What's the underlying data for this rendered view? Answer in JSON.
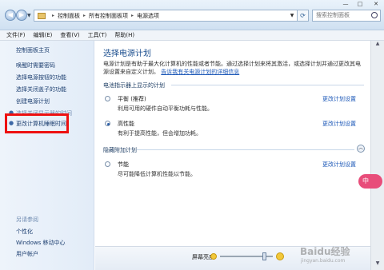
{
  "address_bar": {
    "crumbs": [
      "控制面板",
      "所有控制面板项",
      "电源选项"
    ],
    "search_placeholder": "搜索控制面板"
  },
  "window_controls": [
    "—",
    "□",
    "✕"
  ],
  "menu": [
    "文件(F)",
    "编辑(E)",
    "查看(V)",
    "工具(T)",
    "帮助(H)"
  ],
  "sidebar": {
    "home": "控制面板主页",
    "items": [
      "唤醒时需要密码",
      "选择电源按钮的功能",
      "选择关闭盖子的功能",
      "创建电源计划",
      "选择关闭显示器的时间",
      "更改计算机睡眠时间"
    ],
    "see_also_title": "另请参阅",
    "see_also": [
      "个性化",
      "Windows 移动中心",
      "用户帐户"
    ]
  },
  "main": {
    "title": "选择电源计划",
    "desc_1": "电源计划是有助于最大化计算机的性能或者节能。通过选择计划来将其激活，或选择计划并通过更改其电源设置来自定义计划。",
    "desc_link": "告诉我有关电源计划的详细信息",
    "group1_title": "电池指示器上显示的计划",
    "group2_title": "隐藏附加计划",
    "plans": [
      {
        "name": "平衡 (推荐)",
        "desc": "利用可用的硬件自动平衡功耗与性能。",
        "link": "更改计划设置",
        "selected": false
      },
      {
        "name": "高性能",
        "desc": "有利于提高性能，但会增加功耗。",
        "link": "更改计划设置",
        "selected": true
      },
      {
        "name": "节能",
        "desc": "尽可能降低计算机性能以节能。",
        "link": "更改计划设置",
        "selected": false
      }
    ]
  },
  "status": {
    "brightness_label": "屏幕亮度:",
    "brightness_level": 0.85
  },
  "overlay": {
    "badge": "中",
    "watermark": "Baidu经验",
    "watermark_sub": "jingyan.baidu.com"
  }
}
